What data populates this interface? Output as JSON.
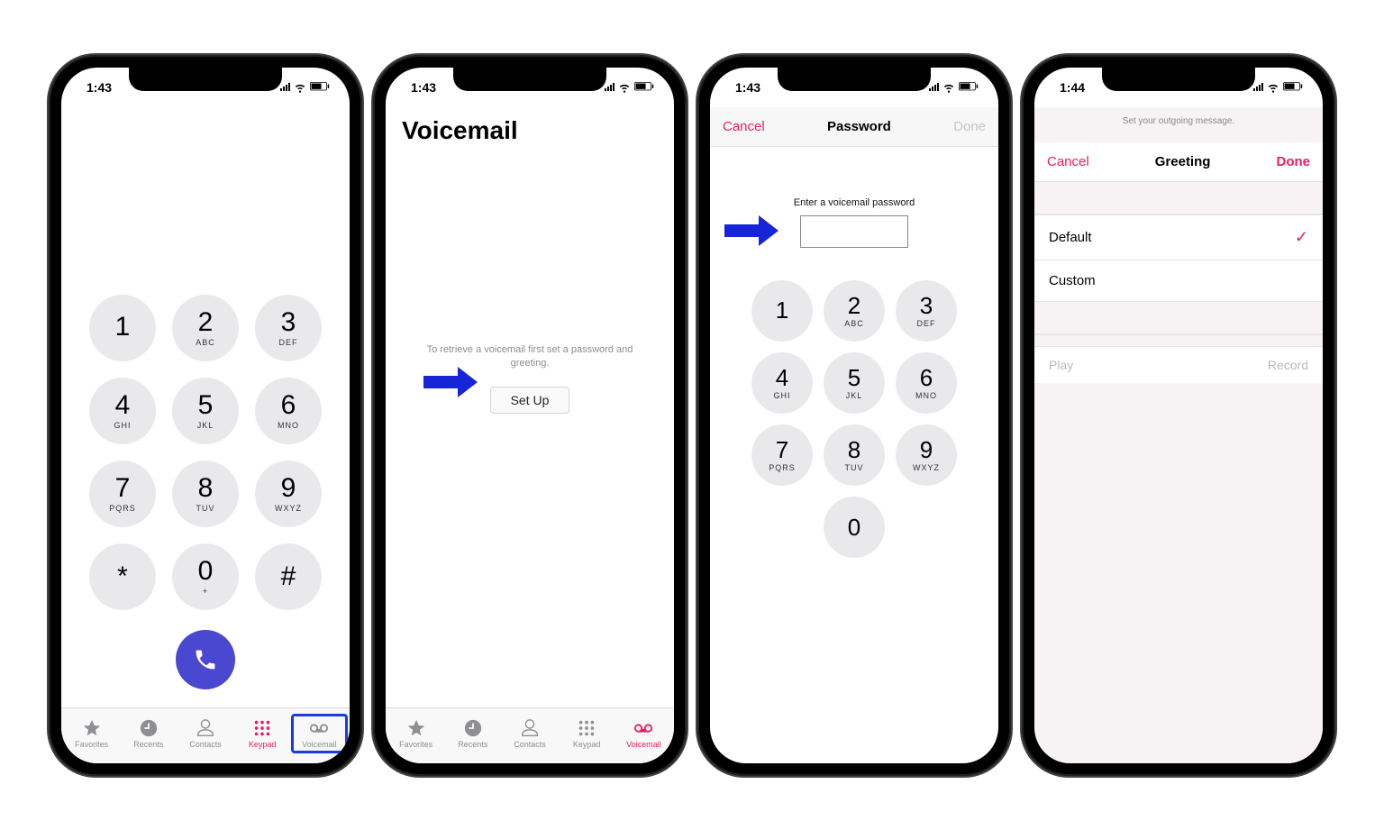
{
  "status": {
    "time1": "1:43",
    "time2": "1:43",
    "time3": "1:43",
    "time4": "1:44"
  },
  "keypad": {
    "keys": [
      {
        "digit": "1",
        "letters": ""
      },
      {
        "digit": "2",
        "letters": "ABC"
      },
      {
        "digit": "3",
        "letters": "DEF"
      },
      {
        "digit": "4",
        "letters": "GHI"
      },
      {
        "digit": "5",
        "letters": "JKL"
      },
      {
        "digit": "6",
        "letters": "MNO"
      },
      {
        "digit": "7",
        "letters": "PQRS"
      },
      {
        "digit": "8",
        "letters": "TUV"
      },
      {
        "digit": "9",
        "letters": "WXYZ"
      },
      {
        "digit": "*",
        "letters": ""
      },
      {
        "digit": "0",
        "letters": "+"
      },
      {
        "digit": "#",
        "letters": ""
      }
    ]
  },
  "tabs": {
    "favorites": "Favorites",
    "recents": "Recents",
    "contacts": "Contacts",
    "keypad": "Keypad",
    "voicemail": "Voicemail"
  },
  "screen2": {
    "title": "Voicemail",
    "message": "To retrieve a voicemail first set a password and greeting.",
    "setup": "Set Up"
  },
  "screen3": {
    "cancel": "Cancel",
    "title": "Password",
    "done": "Done",
    "prompt": "Enter a voicemail password"
  },
  "screen4": {
    "topmsg": "Set your outgoing message.",
    "cancel": "Cancel",
    "title": "Greeting",
    "done": "Done",
    "default": "Default",
    "custom": "Custom",
    "play": "Play",
    "record": "Record"
  }
}
